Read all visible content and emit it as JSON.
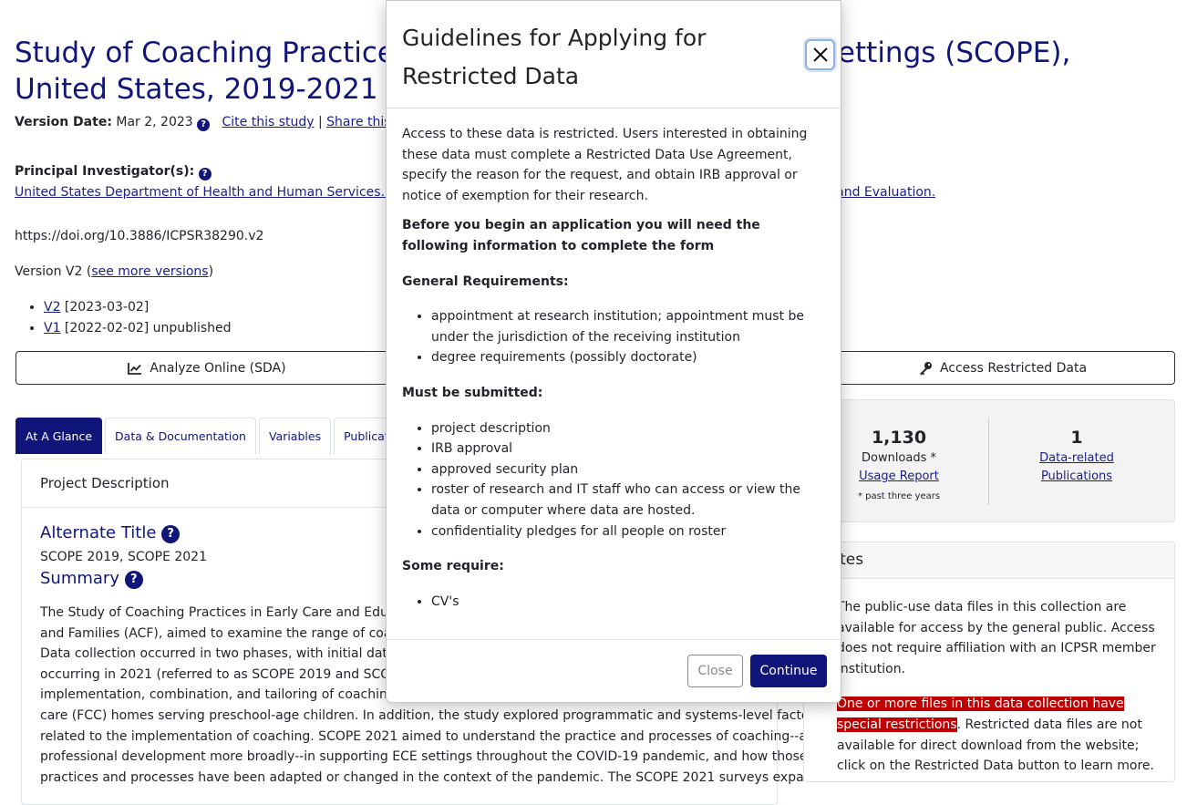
{
  "page": {
    "title": "Study of Coaching Practices in Early Care and Education Settings (SCOPE), United States, 2019-2021 (ICPSR 38290)",
    "version_date_label": "Version Date:",
    "version_date": "Mar 2, 2023",
    "cite_link": "Cite this study",
    "separator": "|",
    "share_link": "Share this page",
    "pi_label": "Principal Investigator(s):",
    "pi_value": "United States Department of Health and Human Services. Administration for Children and Families. Office of Planning, Research and Evaluation.",
    "doi": "https://doi.org/10.3886/ICPSR38290.v2",
    "version_text": "Version V2 (",
    "see_more_versions": "see more versions",
    "version_close": ")",
    "versions": [
      {
        "link": "V2",
        "text": " [2023-03-02]"
      },
      {
        "link": "V1",
        "text": " [2022-02-02] unpublished"
      }
    ],
    "analyze_button": "Analyze Online (SDA)",
    "access_button": "Access Restricted Data"
  },
  "tabs": [
    "At A Glance",
    "Data & Documentation",
    "Variables",
    "Publications"
  ],
  "project": {
    "header": "Project Description",
    "alt_title_heading": "Alternate Title",
    "alt_title_value": "SCOPE 2019, SCOPE 2021",
    "summary_heading": "Summary",
    "summary_lines": [
      "The Study of Coaching Practices in Early Care and Education Settings (SCOPE), sponsored by the Administration for Children",
      "and Families (ACF), aimed to examine the range of coaching practices in ECE settings across the United States.",
      "Data collection occurred in two phases, with initial data collection occurring in 2019 and a second round of data collection",
      "occurring in 2021 (referred to as SCOPE 2019 and SCOPE 2021). The SCOPE 2019 study aimed to learn more about the",
      "implementation, combination, and tailoring of coaching features in center-based classrooms and family child",
      "care (FCC) homes serving preschool-age children. In addition, the study explored programmatic and systems-level factors",
      "related to the implementation of coaching. SCOPE 2021 aimed to understand the practice and processes of coaching--and",
      "professional development more broadly--in supporting ECE settings throughout the COVID-19 pandemic, and how those",
      "practices and processes have been adapted or changed in the context of the pandemic. The SCOPE 2021 surveys expanded"
    ]
  },
  "stats": {
    "downloads_num": "1,130",
    "downloads_label": "Downloads *",
    "usage_link": "Usage Report",
    "footnote": "* past three years",
    "pubs_num": "1",
    "pubs_link_1": "Data-related",
    "pubs_link_2": "Publications"
  },
  "notes": {
    "header": "Notes",
    "para1": "The public-use data files in this collection are available for access by the general public. Access does not require affiliation with an ICPSR member institution.",
    "highlight": "One or more files in this data collection have special restrictions",
    "para2_rest": ". Restricted data files are not available for direct download from the website; click on the Restricted Data button to learn more."
  },
  "modal": {
    "title": "Guidelines for Applying for Restricted Data",
    "intro": "Access to these data is restricted. Users interested in obtaining these data must complete a Restricted Data Use Agreement, specify the reason for the request, and obtain IRB approval or notice of exemption for their research.",
    "before": "Before you begin an application you will need the following information to complete the form",
    "general_heading": "General Requirements:",
    "general_items": [
      "appointment at research institution; appointment must be under the jurisdiction of the receiving institution",
      "degree requirements (possibly doctorate)"
    ],
    "must_heading": "Must be submitted:",
    "must_items": [
      "project description",
      "IRB approval",
      "approved security plan",
      "roster of research and IT staff who can access or view the data or computer where data are hosted.",
      "confidentiality pledges for all people on roster"
    ],
    "some_heading": "Some require:",
    "some_items": [
      "CV's"
    ],
    "close_button": "Close",
    "continue_button": "Continue"
  },
  "colors": {
    "brand": "#10157a",
    "highlight": "#c00000"
  }
}
